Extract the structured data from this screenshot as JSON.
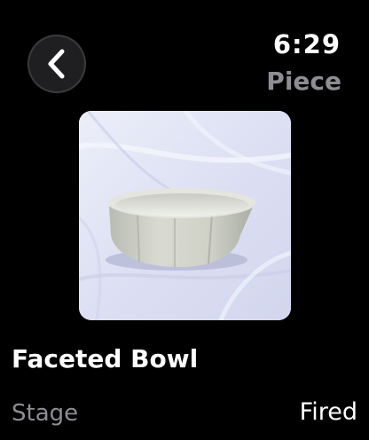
{
  "status_bar": {
    "time": "6:29"
  },
  "header": {
    "back_icon": "chevron-left-icon",
    "title": "Piece"
  },
  "piece": {
    "photo_subject": "faceted-bowl-photo",
    "name": "Faceted Bowl",
    "details": [
      {
        "label": "Stage",
        "value": "Fired"
      }
    ]
  },
  "colors": {
    "background": "#000000",
    "primary_text": "#ffffff",
    "secondary_text": "#8d8d93",
    "button_background": "#1f1f21"
  }
}
